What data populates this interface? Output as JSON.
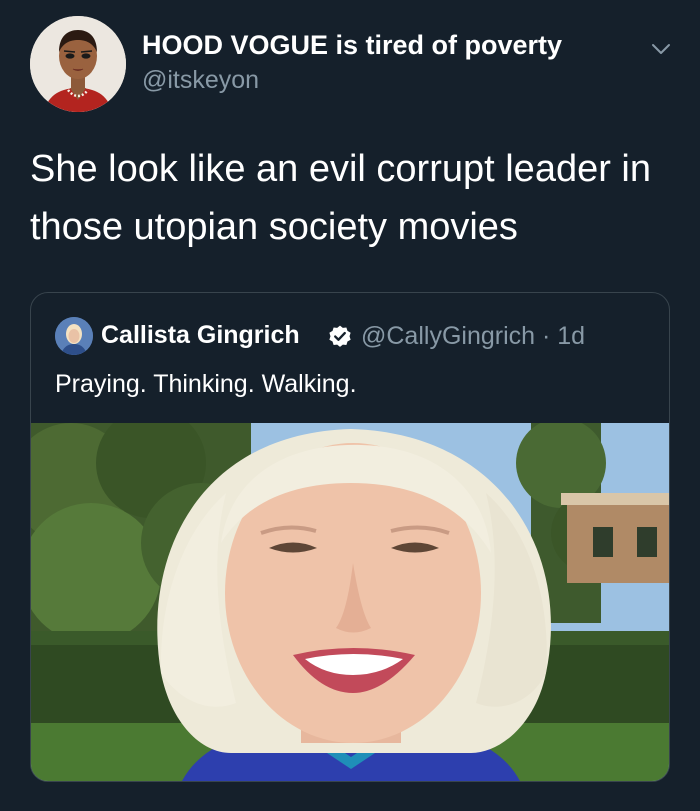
{
  "author": {
    "display_name": "HOOD VOGUE is tired of poverty",
    "handle": "@itskeyon",
    "avatar_icon": "cartoon-avatar"
  },
  "tweet": {
    "text": "She look like an evil corrupt leader in those utopian society movies"
  },
  "quoted_tweet": {
    "display_name": "Callista Gingrich",
    "verified": true,
    "handle": "@CallyGingrich",
    "separator": " · ",
    "time": "1d",
    "text": "Praying. Thinking. Walking.",
    "media_icon": "photo"
  },
  "colors": {
    "background": "#15202b",
    "border": "#38444d",
    "secondary_text": "#8899a6",
    "verified": "#ffffff"
  }
}
